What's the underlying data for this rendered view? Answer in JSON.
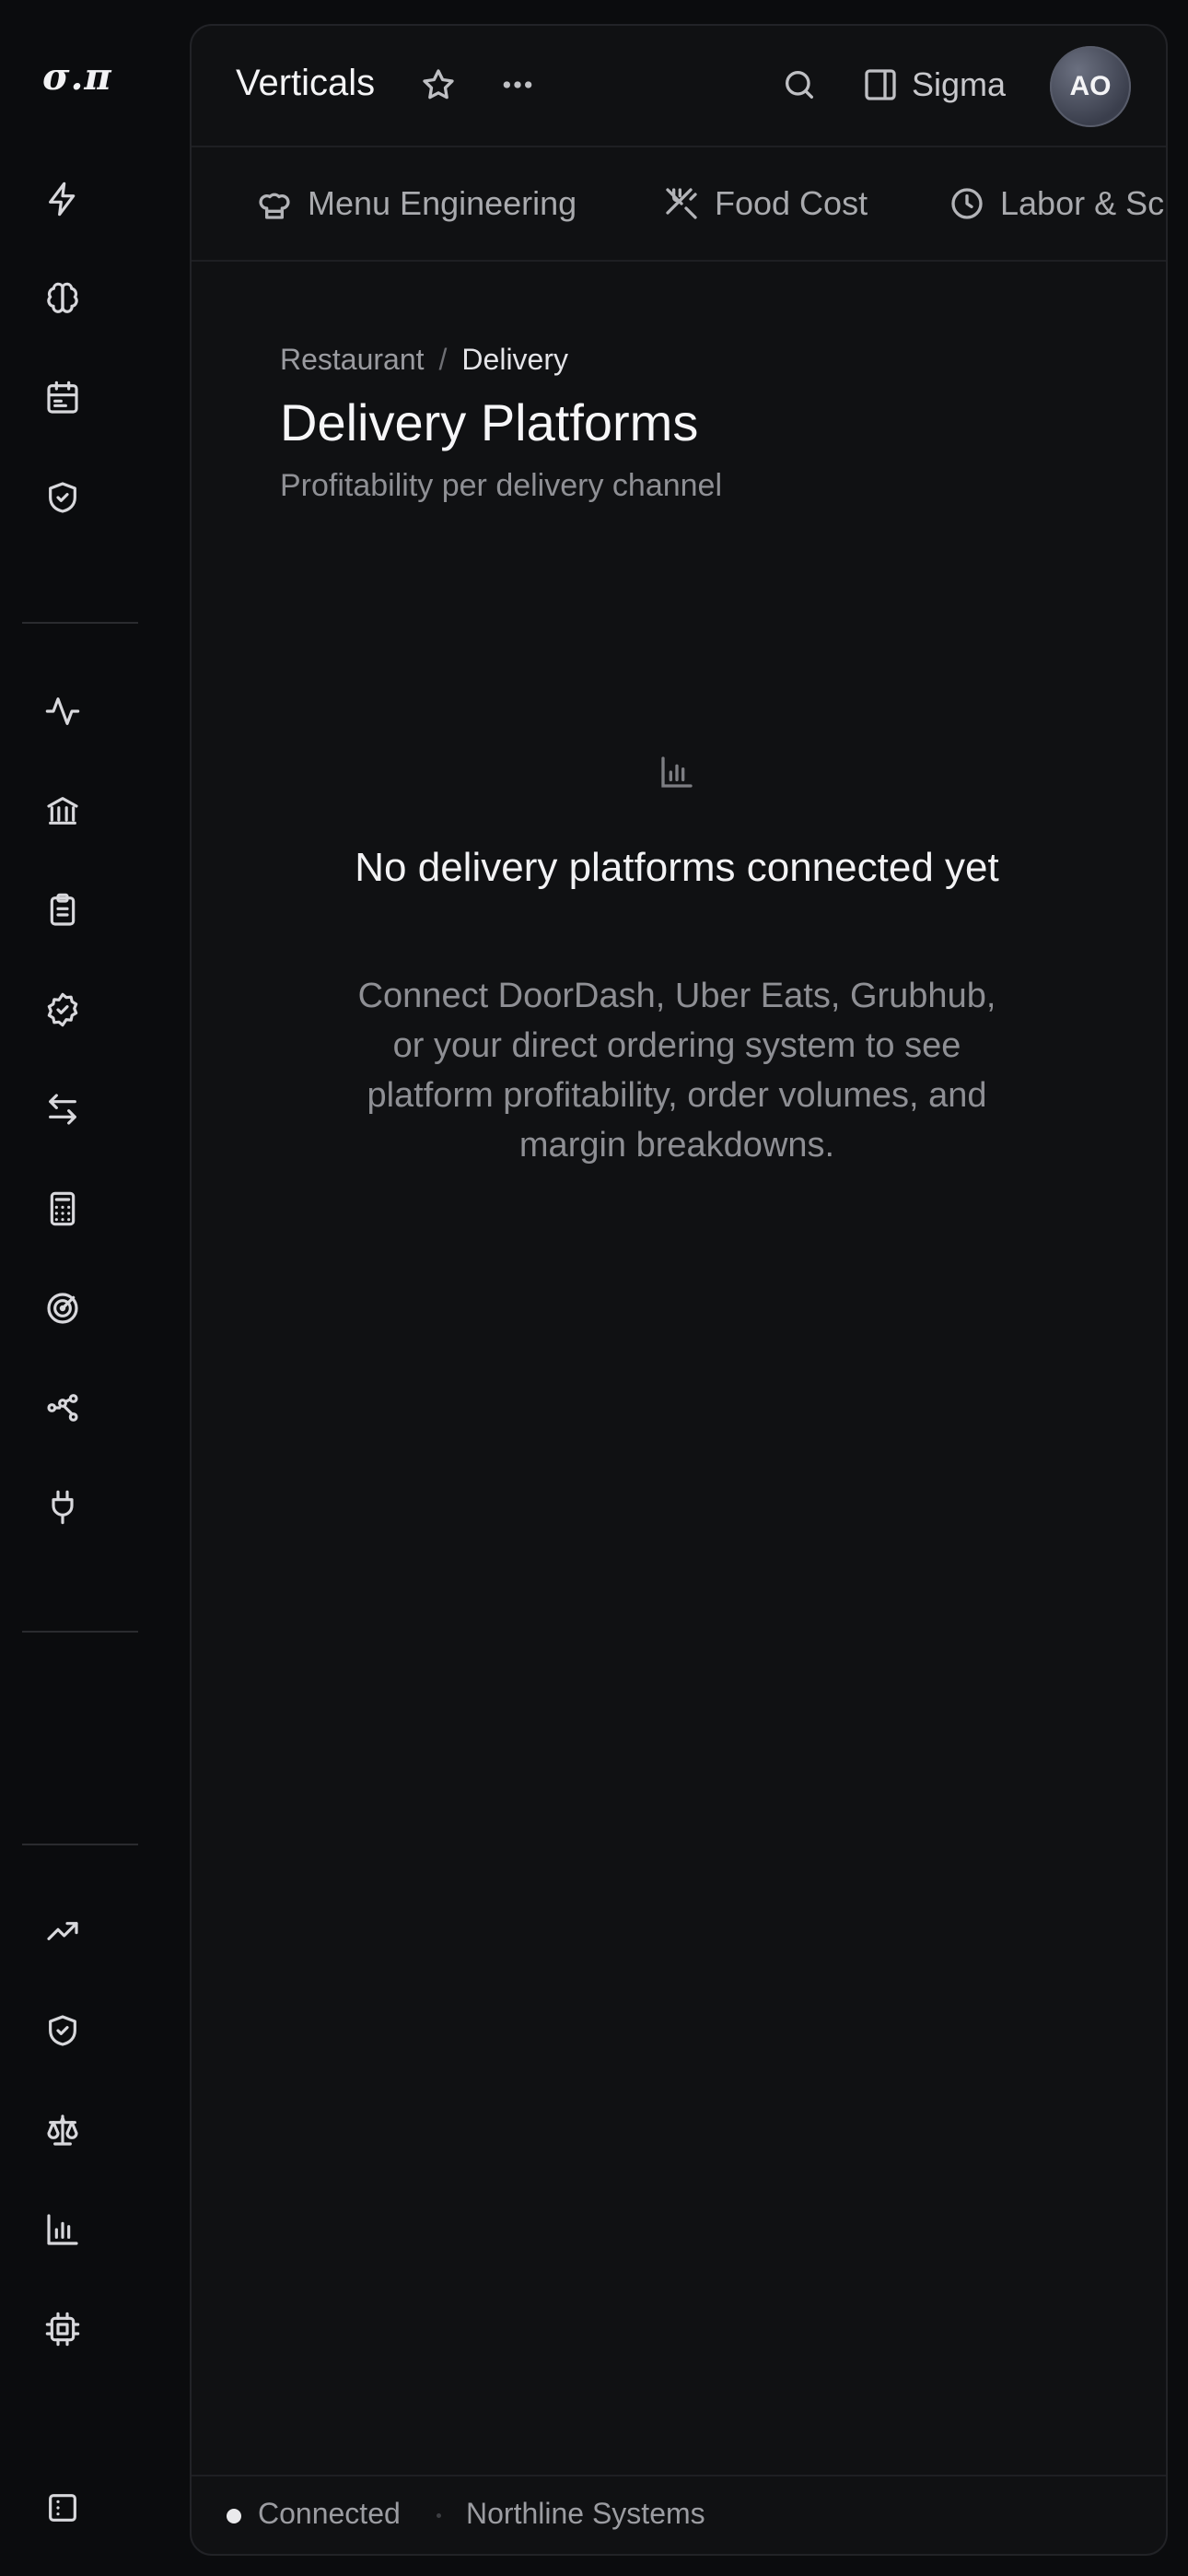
{
  "app": {
    "logo": "σ.π"
  },
  "rail": {
    "group1": [
      "lightning-icon",
      "brain-icon",
      "calendar-icon",
      "shield-check-icon"
    ],
    "group2": [
      "activity-icon",
      "bank-icon",
      "clipboard-icon",
      "badge-check-icon",
      "arrows-left-right-icon",
      "calculator-icon",
      "target-icon",
      "workflow-icon",
      "plug-icon"
    ],
    "group3": [
      "trending-up-icon",
      "shield-check-icon",
      "scale-icon",
      "bar-chart-icon",
      "cpu-icon"
    ],
    "bottom": "sidebar-toggle-icon"
  },
  "header": {
    "title": "Verticals",
    "sigma_label": "Sigma",
    "avatar_initials": "AO"
  },
  "tabs": [
    {
      "label": "Menu Engineering",
      "icon": "chef-hat-icon"
    },
    {
      "label": "Food Cost",
      "icon": "utensils-crossed-icon"
    },
    {
      "label": "Labor & Sc",
      "icon": "clock-icon"
    }
  ],
  "breadcrumb": {
    "parent": "Restaurant",
    "separator": "/",
    "current": "Delivery"
  },
  "page": {
    "title": "Delivery Platforms",
    "subtitle": "Profitability per delivery channel"
  },
  "empty_state": {
    "icon": "bar-chart-icon",
    "title": "No delivery platforms connected yet",
    "description": "Connect DoorDash, Uber Eats, Grubhub, or your direct ordering system to see platform profitability, order volumes, and margin breakdowns."
  },
  "status": {
    "connection": "Connected",
    "company": "Northline Systems"
  },
  "colors": {
    "background": "#0b0c0e",
    "panel": "#101113",
    "text": "#f2f2f4",
    "muted": "#8e8f94"
  }
}
